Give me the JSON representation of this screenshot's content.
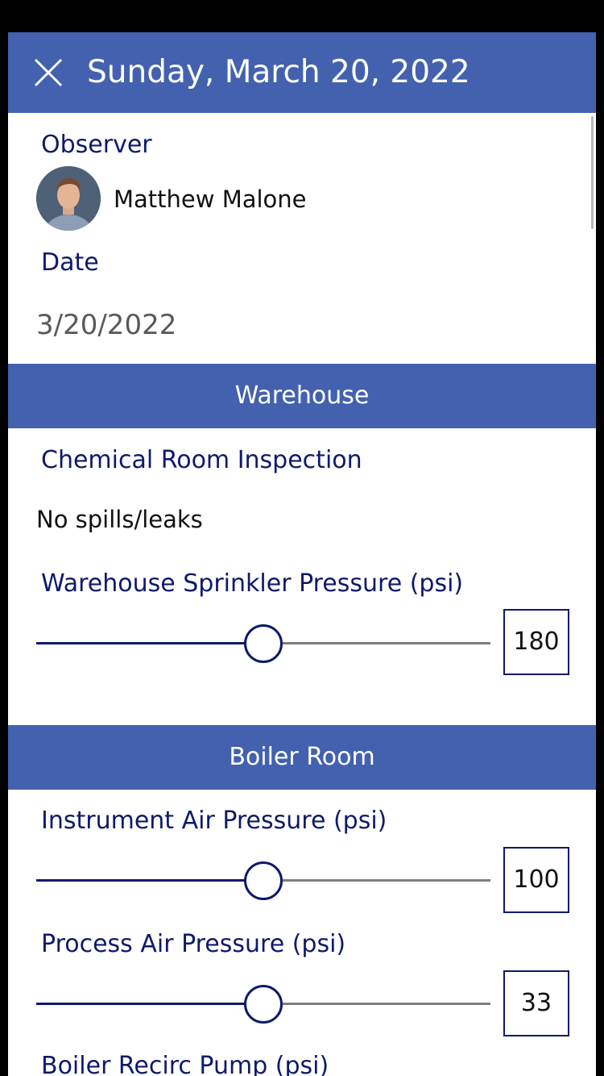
{
  "header": {
    "title": "Sunday, March 20, 2022",
    "close_icon": "close-icon"
  },
  "observer": {
    "label": "Observer",
    "name": "Matthew Malone"
  },
  "date": {
    "label": "Date",
    "value": "3/20/2022"
  },
  "sections": {
    "warehouse": {
      "title": "Warehouse",
      "chemical_label": "Chemical Room Inspection",
      "chemical_value": "No spills/leaks",
      "sprinkler_label": "Warehouse Sprinkler Pressure (psi)",
      "sprinkler_value": "180",
      "sprinkler_level": 0.5
    },
    "boiler": {
      "title": "Boiler Room",
      "instrument_label": "Instrument Air Pressure (psi)",
      "instrument_value": "100",
      "instrument_level": 0.5,
      "process_label": "Process Air Pressure (psi)",
      "process_value": "33",
      "process_level": 0.5,
      "pump_label": "Boiler Recirc Pump (psi)"
    }
  },
  "colors": {
    "accent": "#4361ae",
    "label": "#0d1a6b"
  }
}
